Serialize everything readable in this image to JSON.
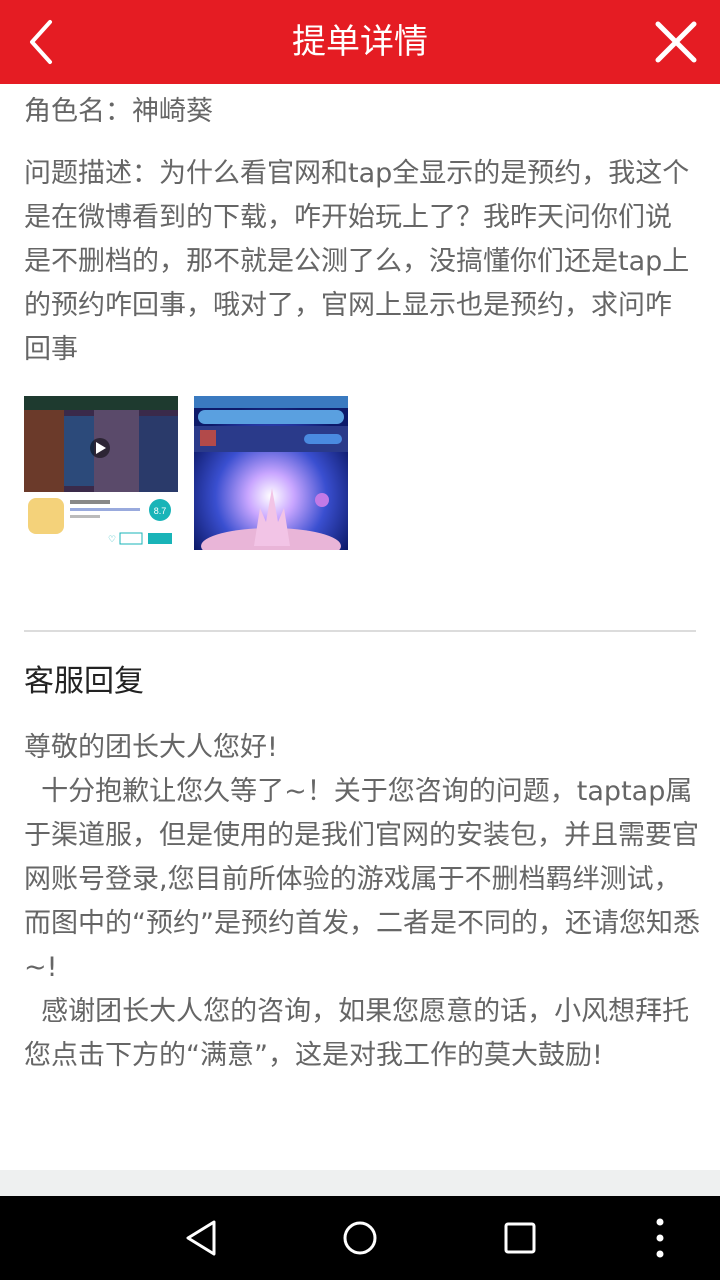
{
  "header": {
    "title": "提单详情",
    "accent": "#e51c23",
    "back_icon": "chevron-left-icon",
    "close_icon": "close-icon"
  },
  "ticket": {
    "role_line": "角色名：神崎葵",
    "description": "问题描述：为什么看官网和tap全显示的是预约，我这个是在微博看到的下载，咋开始玩上了？我昨天问你们说是不删档的，那不就是公测了么，没搞懂你们还是tap上的预约咋回事，哦对了，官网上显示也是预约，求问咋回事",
    "attachments": [
      {
        "label": "screenshot-1",
        "rating": "8.7"
      },
      {
        "label": "screenshot-2"
      }
    ]
  },
  "reply": {
    "title": "客服回复",
    "body": "尊敬的团长大人您好!\n  十分抱歉让您久等了~！关于您咨询的问题，taptap属于渠道服，但是使用的是我们官网的安装包，并且需要官网账号登录,您目前所体验的游戏属于不删档羁绊测试，而图中的“预约”是预约首发，二者是不同的，还请您知悉~!\n  感谢团长大人您的咨询，如果您愿意的话，小风想拜托您点击下方的“满意”，这是对我工作的莫大鼓励!"
  },
  "navbar": {
    "icons": [
      "back-triangle-icon",
      "home-circle-icon",
      "recents-square-icon",
      "more-dots-icon"
    ]
  }
}
